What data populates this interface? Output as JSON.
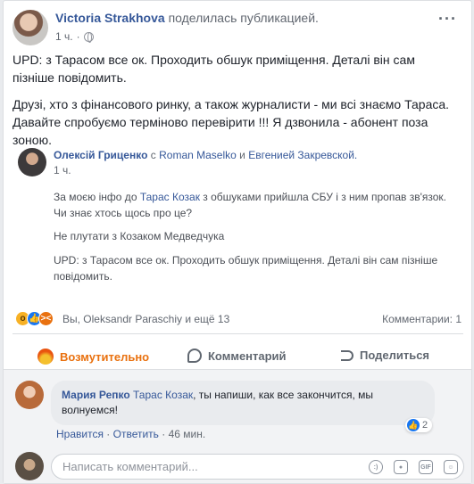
{
  "post": {
    "author": "Victoria Strakhova",
    "action_text": "поделилась публикацией.",
    "time": "1 ч.",
    "more_label": "···",
    "text_lines": [
      "UPD: з Тарасом все ок. Проходить обшук приміщення. Деталі він сам",
      "пізніше повідомить.",
      "Друзі, хто з фінансового ринку, а також журналисти - ми всі знаємо Тараса.",
      "Давайте спробуємо терміново перевірити !!! Я дзвонила - абонент поза",
      "зоною."
    ]
  },
  "shared": {
    "author": "Олексій Гриценко",
    "with_prefix": "с",
    "with_person_1": "Roman Maselko",
    "and_word": "и",
    "with_person_2": "Евгенией Закревской.",
    "time": "1 ч.",
    "quote_1_line_1_prefix": "За моєю інфо до",
    "quote_1_mention": "Тарас Козак",
    "quote_1_line_1_suffix": "з обшуками прийшла СБУ і з ним пропав зв'язок.",
    "quote_1_line_2": "Чи знає хтось щось про це?",
    "quote_2": "Не плутати з Козаком Медведчука",
    "quote_3_line_1": "UPD: з Тарасом все ок. Проходить обшук приміщення. Деталі він сам пізніше",
    "quote_3_line_2": "повідомить."
  },
  "reactions": {
    "summary": "Вы, Oleksandr Paraschiy и ещё 13",
    "comments_count": "Комментарии: 1"
  },
  "actions": {
    "react_label": "Возмутительно",
    "comment_label": "Комментарий",
    "share_label": "Поделиться"
  },
  "comment": {
    "author": "Мария Репко",
    "mention": "Тарас Козак",
    "text_part_1": ", ты напиши, как все закончится, мы",
    "text_part_2": "волнуемся!",
    "likes": "2",
    "like_label": "Нравится",
    "separator": "·",
    "reply_label": "Ответить",
    "time": "46 мин."
  },
  "composer": {
    "placeholder": "Написать комментарий...",
    "gif_label": "GIF"
  },
  "colors": {
    "link": "#365899",
    "angry": "#e9710f",
    "like": "#1877f2"
  }
}
